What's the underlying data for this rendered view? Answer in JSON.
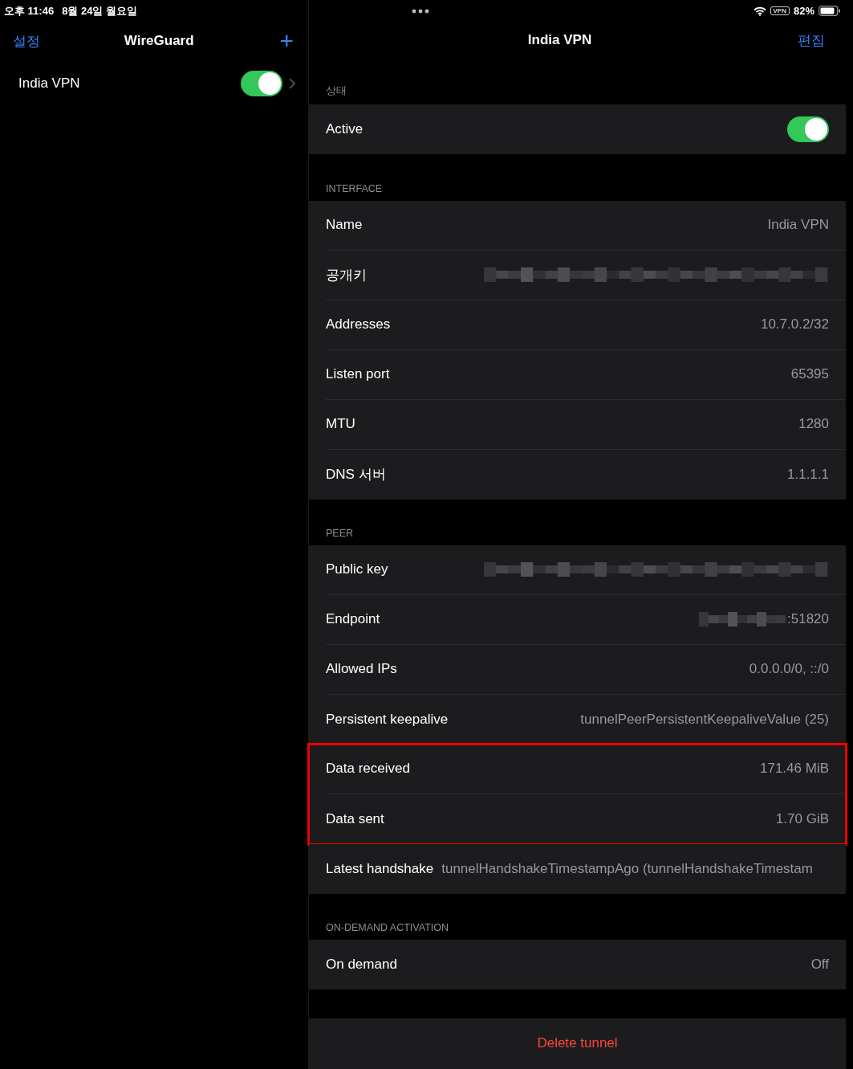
{
  "status_bar": {
    "time": "오후 11:46",
    "date": "8월 24일 월요일",
    "vpn_badge": "VPN",
    "battery": "82%"
  },
  "sidebar": {
    "back": "설정",
    "title": "WireGuard",
    "add": "+",
    "tunnels": [
      {
        "name": "India VPN",
        "on": true
      }
    ]
  },
  "detail": {
    "title": "India VPN",
    "edit": "편집",
    "sections": [
      {
        "header": "상태",
        "groups": [
          {
            "highlighted": false,
            "rows": [
              {
                "kind": "toggle",
                "label": "Active",
                "on": true
              }
            ]
          }
        ]
      },
      {
        "header": "INTERFACE",
        "groups": [
          {
            "highlighted": false,
            "rows": [
              {
                "kind": "value",
                "label": "Name",
                "value": "India VPN"
              },
              {
                "kind": "redacted",
                "label": "공개키"
              },
              {
                "kind": "value",
                "label": "Addresses",
                "value": "10.7.0.2/32"
              },
              {
                "kind": "value",
                "label": "Listen port",
                "value": "65395"
              },
              {
                "kind": "value",
                "label": "MTU",
                "value": "1280"
              },
              {
                "kind": "value",
                "label": "DNS 서버",
                "value": "1.1.1.1"
              }
            ]
          }
        ]
      },
      {
        "header": "PEER",
        "groups": [
          {
            "highlighted": false,
            "rows": [
              {
                "kind": "redacted",
                "label": "Public key"
              },
              {
                "kind": "redacted",
                "label": "Endpoint",
                "value": ":51820"
              },
              {
                "kind": "value",
                "label": "Allowed IPs",
                "value": "0.0.0.0/0, ::/0"
              },
              {
                "kind": "value",
                "label": "Persistent keepalive",
                "value": "tunnelPeerPersistentKeepaliveValue (25)"
              }
            ]
          },
          {
            "highlighted": true,
            "rows": [
              {
                "kind": "value",
                "label": "Data received",
                "value": "171.46 MiB"
              },
              {
                "kind": "value",
                "label": "Data sent",
                "value": "1.70 GiB"
              }
            ]
          },
          {
            "highlighted": false,
            "rows": [
              {
                "kind": "inline",
                "label": "Latest handshake",
                "value": "tunnelHandshakeTimestampAgo (tunnelHandshakeTimestam"
              }
            ]
          }
        ]
      },
      {
        "header": "ON-DEMAND ACTIVATION",
        "groups": [
          {
            "highlighted": false,
            "rows": [
              {
                "kind": "value",
                "label": "On demand",
                "value": "Off"
              }
            ]
          }
        ]
      }
    ],
    "delete": "Delete tunnel"
  }
}
